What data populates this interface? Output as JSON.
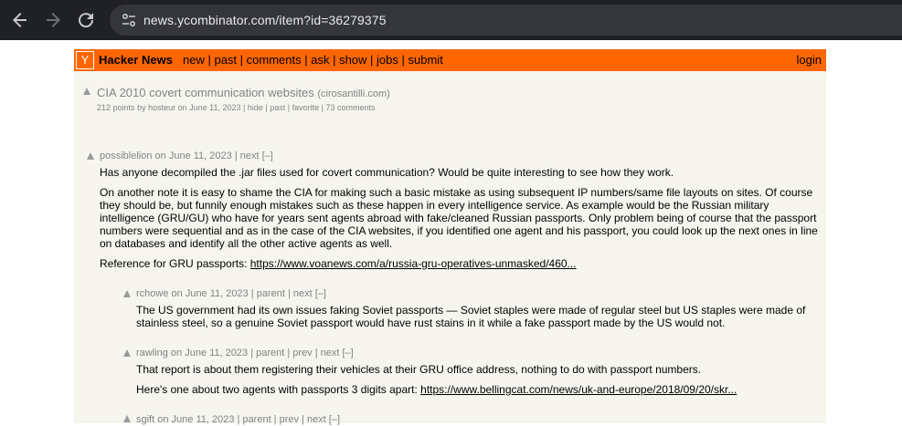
{
  "browser": {
    "url": "news.ycombinator.com/item?id=36279375"
  },
  "header": {
    "logo": "Y",
    "brand": "Hacker News",
    "nav": [
      "new",
      "past",
      "comments",
      "ask",
      "show",
      "jobs",
      "submit"
    ],
    "separator": " | ",
    "login": "login"
  },
  "story": {
    "title": "CIA 2010 covert communication websites",
    "site": "(cirosantilli.com)",
    "points": "212 points",
    "by": "by",
    "user": "hosteur",
    "date": "on June 11, 2023",
    "links": [
      "hide",
      "past",
      "favorite",
      "73 comments"
    ]
  },
  "comments": [
    {
      "user": "possiblelion",
      "date": "on June 11, 2023",
      "links": "| next [–]",
      "paragraphs": [
        "Has anyone decompiled the .jar files used for covert communication? Would be quite interesting to see how they work.",
        "On another note it is easy to shame the CIA for making such a basic mistake as using subsequent IP numbers/same file layouts on sites. Of course they should be, but funnily enough mistakes such as these happen in every intelligence service. As example would be the Russian military intelligence (GRU/GU) who have for years sent agents abroad with fake/cleaned Russian passports. Only problem being of course that the passport numbers were sequential and as in the case of the CIA websites, if you identified one agent and his passport, you could look up the next ones in line on databases and identify all the other active agents as well."
      ],
      "ref_label": "Reference for GRU passports: ",
      "ref_link": "https://www.voanews.com/a/russia-gru-operatives-unmasked/460..."
    },
    {
      "user": "rchowe",
      "date": "on June 11, 2023",
      "links": "| parent | next [–]",
      "paragraphs": [
        "The US government had its own issues faking Soviet passports — Soviet staples were made of regular steel but US staples were made of stainless steel, so a genuine Soviet passport would have rust stains in it while a fake passport made by the US would not."
      ]
    },
    {
      "user": "rawling",
      "date": "on June 11, 2023",
      "links": "| parent | prev | next [–]",
      "paragraphs": [
        "That report is about them registering their vehicles at their GRU office address, nothing to do with passport numbers."
      ],
      "ref_label": "Here's one about two agents with passports 3 digits apart: ",
      "ref_link": "https://www.bellingcat.com/news/uk-and-europe/2018/09/20/skr..."
    },
    {
      "user": "sgift",
      "date": "on June 11, 2023",
      "links": "| parent | prev | next [–]"
    }
  ]
}
